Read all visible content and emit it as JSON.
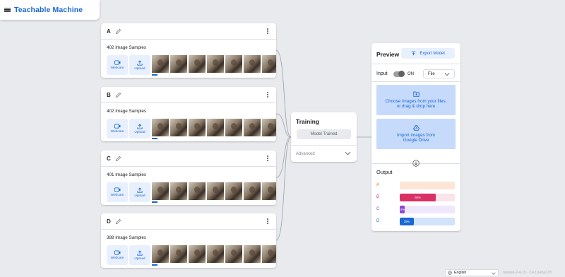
{
  "app": {
    "title": "Teachable Machine"
  },
  "classes": [
    {
      "name": "A",
      "sample_label": "402 Image Samples",
      "webcam_label": "Webcam",
      "upload_label": "Upload"
    },
    {
      "name": "B",
      "sample_label": "402 Image Samples",
      "webcam_label": "Webcam",
      "upload_label": "Upload"
    },
    {
      "name": "C",
      "sample_label": "401 Image Samples",
      "webcam_label": "Webcam",
      "upload_label": "Upload"
    },
    {
      "name": "D",
      "sample_label": "388 Image Samples",
      "webcam_label": "Webcam",
      "upload_label": "Upload"
    }
  ],
  "training": {
    "title": "Training",
    "button_label": "Model Trained",
    "advanced_label": "Advanced"
  },
  "preview": {
    "title": "Preview",
    "export_label": "Export Model",
    "input_label": "Input",
    "toggle_state": "ON",
    "source_value": "File",
    "upload_text_1": "Choose images from your files,",
    "upload_text_2": "or drag & drop here",
    "drive_text_1": "Import images from",
    "drive_text_2": "Google Drive",
    "output_label": "Output",
    "outputs": [
      {
        "label": "A",
        "percent": 0,
        "percent_text": "",
        "color": "#e8710a",
        "bg": "#fde6d6"
      },
      {
        "label": "B",
        "percent": 65,
        "percent_text": "65%",
        "color": "#d93065",
        "bg": "#fbe3ea"
      },
      {
        "label": "C",
        "percent": 9,
        "percent_text": "9%",
        "color": "#8e44d6",
        "bg": "#efe7fb"
      },
      {
        "label": "D",
        "percent": 25,
        "percent_text": "25%",
        "color": "#1967d2",
        "bg": "#d2e3fc"
      }
    ]
  },
  "footer": {
    "language": "English",
    "version": "release-2-4-10 - 2.4.10-k6a178"
  },
  "colors": {
    "accent": "#1967d2",
    "background": "#e8eaed"
  }
}
